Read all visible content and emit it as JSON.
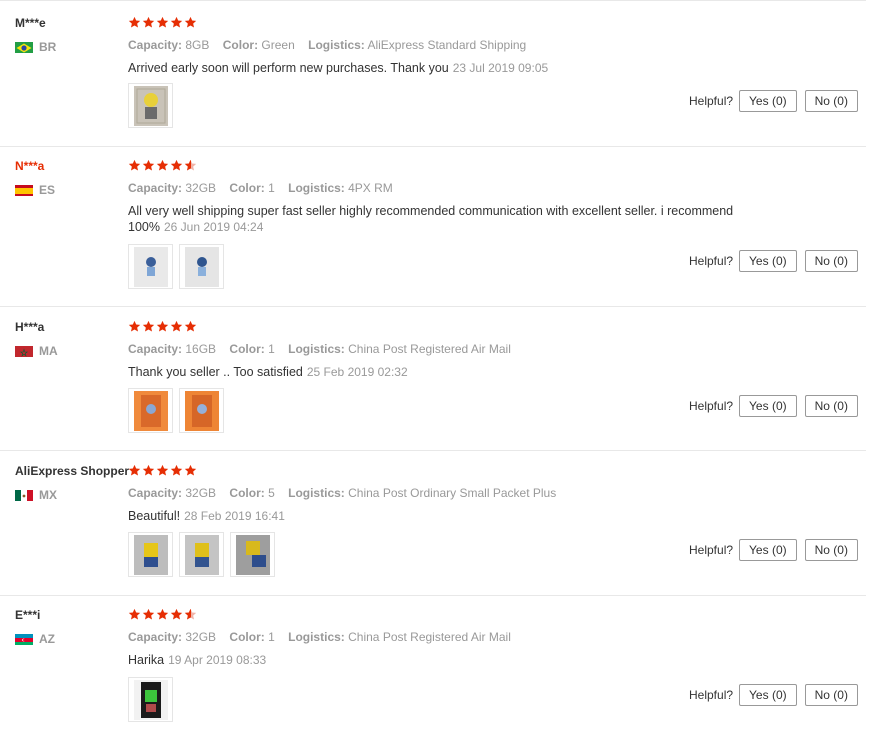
{
  "colors": {
    "star": "#e62e04",
    "brand_red": "#e62e04",
    "muted": "#999999",
    "divider": "#e8e8e8"
  },
  "labels": {
    "capacity": "Capacity:",
    "color": "Color:",
    "logistics": "Logistics:",
    "helpful": "Helpful?"
  },
  "reviews": [
    {
      "user": "M***e",
      "country": "BR",
      "flag": "flag-brazil-icon",
      "stars": 5,
      "capacity": "8GB",
      "color": "Green",
      "logistics": "AliExpress Standard Shipping",
      "text": "Arrived early soon will perform new purchases. Thank you",
      "date": "23 Jul 2019 09:05",
      "photos": 1,
      "yes": "Yes (0)",
      "no": "No (0)"
    },
    {
      "user": "N***a",
      "country": "ES",
      "flag": "flag-spain-icon",
      "stars": 4.5,
      "capacity": "32GB",
      "color": "1",
      "logistics": "4PX RM",
      "text": "All very well shipping super fast seller highly recommended communication with excellent seller. i recommend 100%",
      "date": "26 Jun 2019 04:24",
      "photos": 2,
      "yes": "Yes (0)",
      "no": "No (0)"
    },
    {
      "user": "H***a",
      "country": "MA",
      "flag": "flag-morocco-icon",
      "stars": 5,
      "capacity": "16GB",
      "color": "1",
      "logistics": "China Post Registered Air Mail",
      "text": "Thank you seller .. Too satisfied",
      "date": "25 Feb 2019 02:32",
      "photos": 2,
      "yes": "Yes (0)",
      "no": "No (0)"
    },
    {
      "user": "AliExpress Shopper",
      "country": "MX",
      "flag": "flag-mexico-icon",
      "stars": 5,
      "capacity": "32GB",
      "color": "5",
      "logistics": "China Post Ordinary Small Packet Plus",
      "text": "Beautiful!",
      "date": "28 Feb 2019 16:41",
      "photos": 3,
      "yes": "Yes (0)",
      "no": "No (0)"
    },
    {
      "user": "E***i",
      "country": "AZ",
      "flag": "flag-azerbaijan-icon",
      "stars": 4.5,
      "capacity": "32GB",
      "color": "1",
      "logistics": "China Post Registered Air Mail",
      "text": "Harika",
      "date": "19 Apr 2019 08:33",
      "photos": 1,
      "yes": "Yes (0)",
      "no": "No (0)"
    }
  ]
}
